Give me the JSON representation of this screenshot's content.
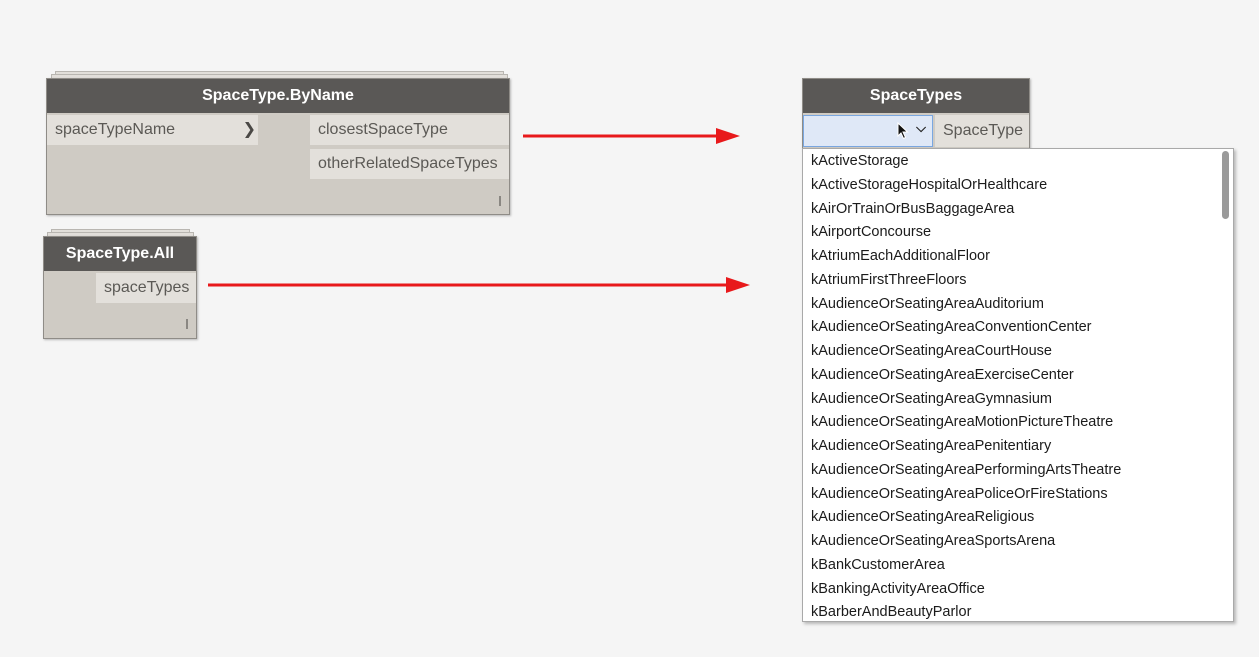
{
  "nodes": {
    "byname": {
      "title": "SpaceType.ByName",
      "input": "spaceTypeName",
      "outputs": [
        "closestSpaceType",
        "otherRelatedSpaceTypes"
      ]
    },
    "all": {
      "title": "SpaceType.All",
      "output": "spaceTypes"
    },
    "spacetypes": {
      "title": "SpaceTypes",
      "selected_value": "",
      "output": "SpaceType"
    }
  },
  "dropdown": {
    "items": [
      "kActiveStorage",
      "kActiveStorageHospitalOrHealthcare",
      "kAirOrTrainOrBusBaggageArea",
      "kAirportConcourse",
      "kAtriumEachAdditionalFloor",
      "kAtriumFirstThreeFloors",
      "kAudienceOrSeatingAreaAuditorium",
      "kAudienceOrSeatingAreaConventionCenter",
      "kAudienceOrSeatingAreaCourtHouse",
      "kAudienceOrSeatingAreaExerciseCenter",
      "kAudienceOrSeatingAreaGymnasium",
      "kAudienceOrSeatingAreaMotionPictureTheatre",
      "kAudienceOrSeatingAreaPenitentiary",
      "kAudienceOrSeatingAreaPerformingArtsTheatre",
      "kAudienceOrSeatingAreaPoliceOrFireStations",
      "kAudienceOrSeatingAreaReligious",
      "kAudienceOrSeatingAreaSportsArena",
      "kBankCustomerArea",
      "kBankingActivityAreaOffice",
      "kBarberAndBeautyParlor"
    ]
  },
  "colors": {
    "arrow": "#e8191b",
    "header": "#5a5856",
    "node_body": "#cfcbc4",
    "combo_highlight": "#dfe8f7"
  },
  "icons": {
    "input_chevron": "chevron-right-icon",
    "combo_caret": "chevron-down-icon",
    "cursor": "mouse-pointer-icon"
  }
}
